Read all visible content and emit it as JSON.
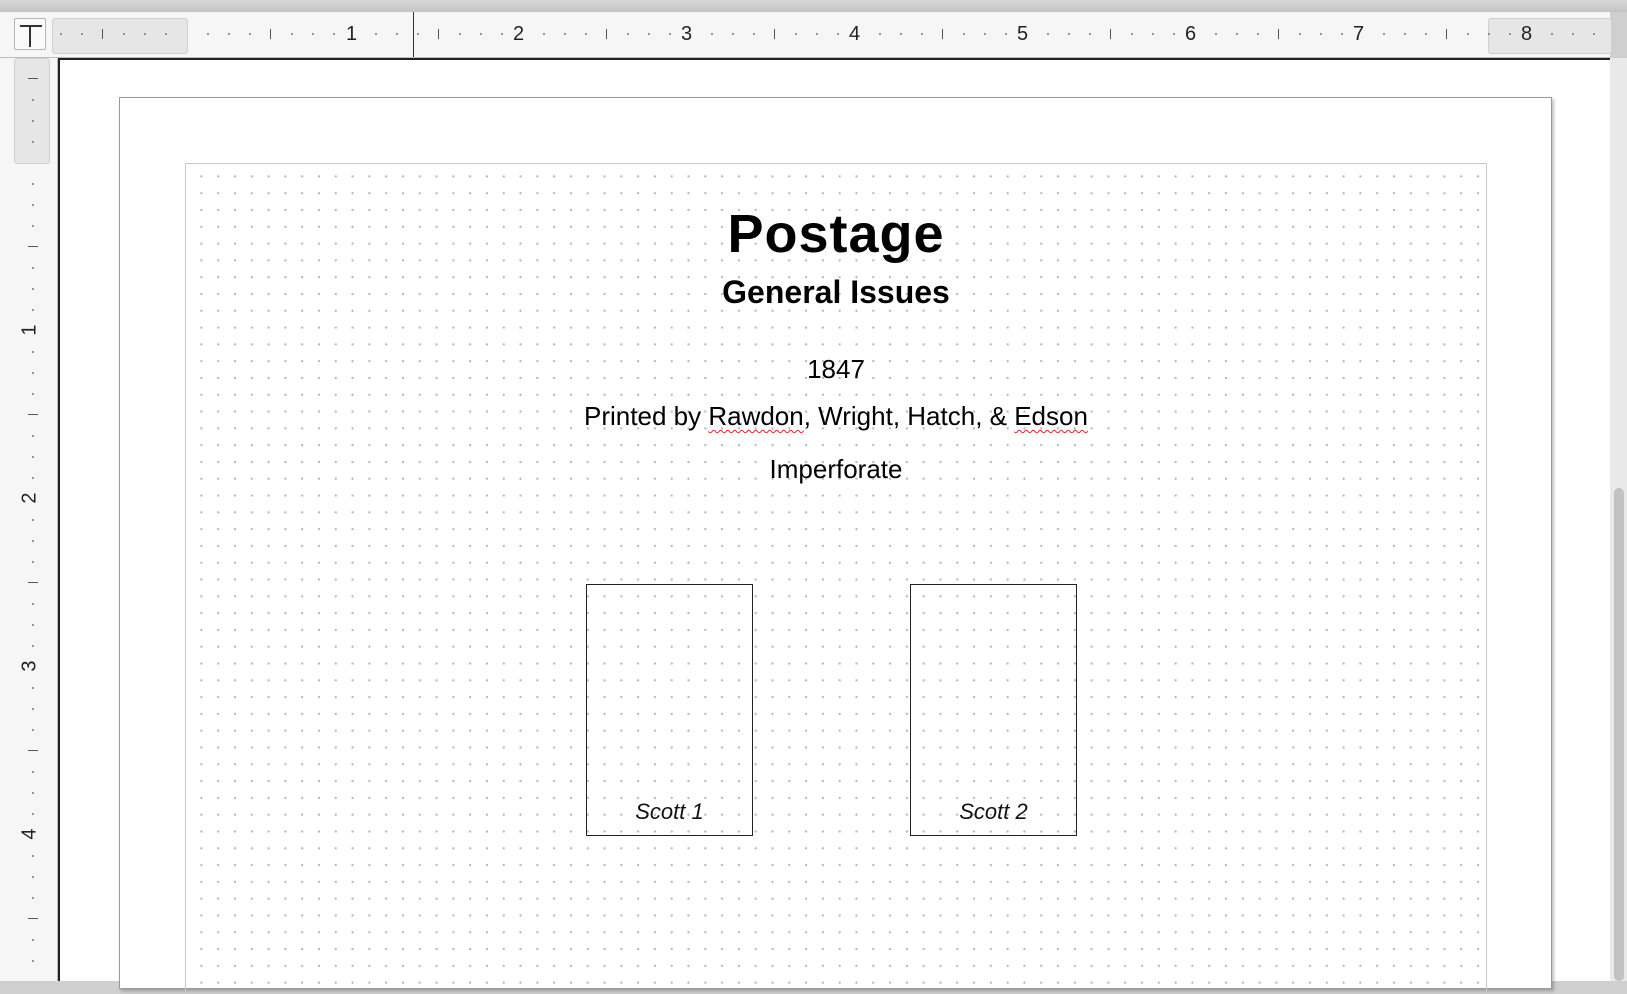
{
  "ruler": {
    "h_numbers": [
      "1",
      "2",
      "3",
      "4",
      "5",
      "6",
      "7",
      "8"
    ],
    "v_numbers": [
      "1",
      "2",
      "3",
      "4"
    ]
  },
  "page": {
    "title": "Postage",
    "subtitle": "General Issues",
    "year": "1847",
    "printer_prefix": "Printed by ",
    "printer_name1": "Rawdon",
    "printer_middle": ", Wright, Hatch, & ",
    "printer_name2": "Edson",
    "perforation": "Imperforate",
    "stamps": [
      {
        "caption": "Scott 1"
      },
      {
        "caption": "Scott 2"
      }
    ]
  }
}
